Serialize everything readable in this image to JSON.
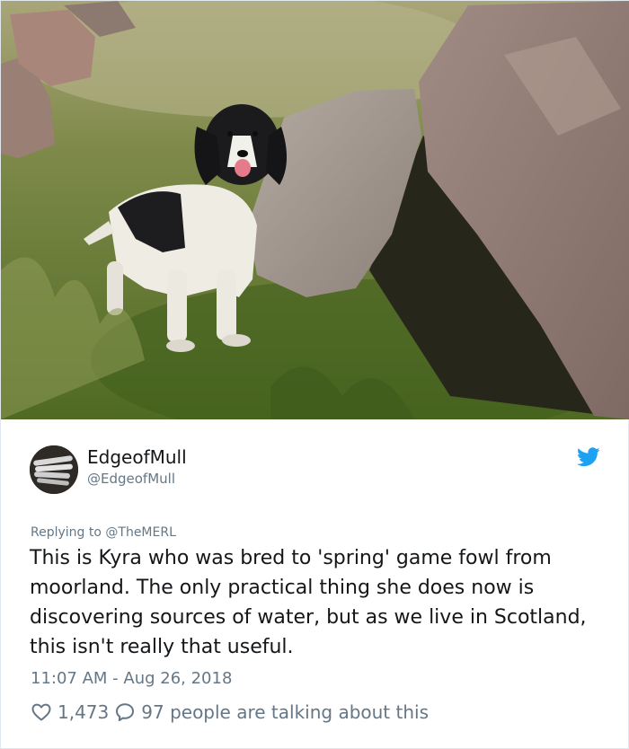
{
  "tweet": {
    "display_name": "EdgeofMull",
    "handle": "@EdgeofMull",
    "replying_prefix": "Replying to ",
    "replying_to": "@TheMERL",
    "text": "This is Kyra who was bred to 'spring' game fowl from moorland. The only practical thing she does now is discovering sources of water, but as we live in Scotland, this isn't really that useful.",
    "timestamp": "11:07 AM - Aug 26, 2018",
    "likes": "1,473",
    "conversation": "97 people are talking about this"
  },
  "icons": {
    "brand": "twitter-bird-icon",
    "like": "heart-icon",
    "reply": "speech-bubble-icon"
  },
  "colors": {
    "twitter_blue": "#1da1f2",
    "secondary_text": "#657786",
    "primary_text": "#14171a"
  }
}
